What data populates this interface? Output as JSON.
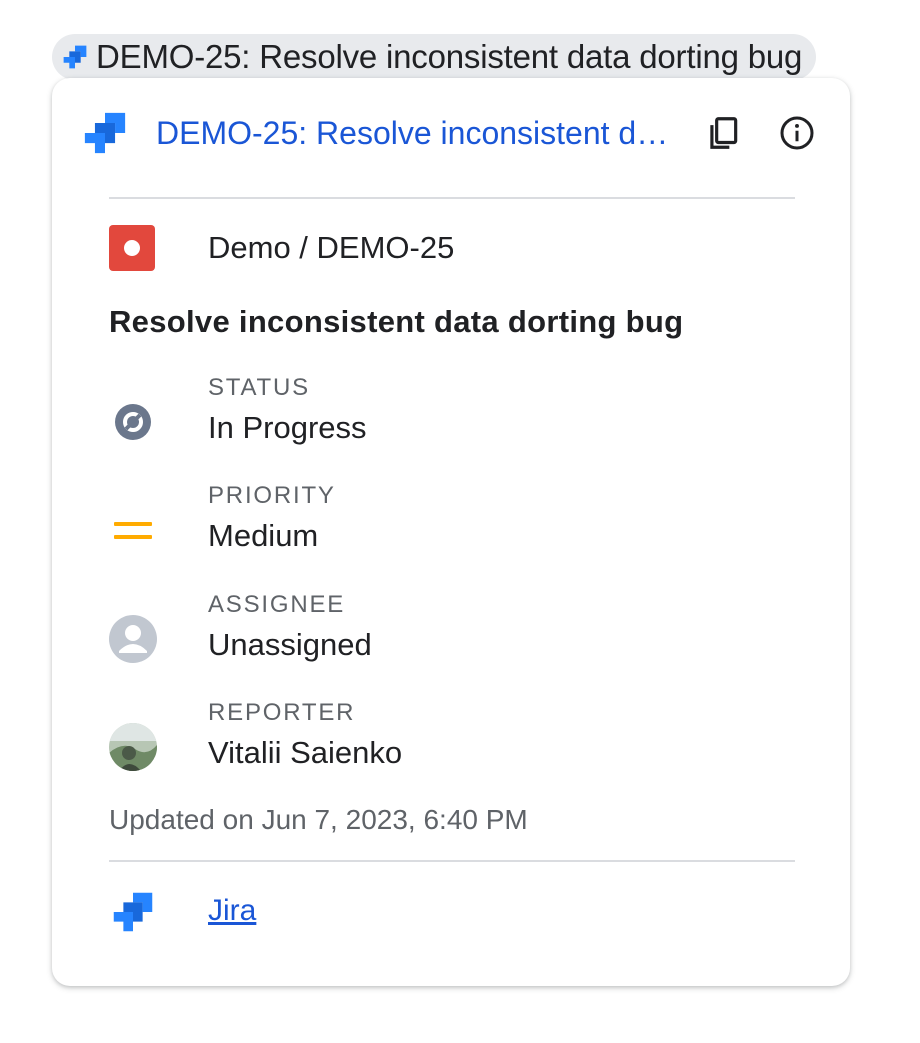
{
  "chip": {
    "text": "DEMO-25: Resolve inconsistent data dorting bug",
    "icon": "jira-icon"
  },
  "card": {
    "title": "DEMO-25: Resolve inconsistent data dorting bug",
    "copy_icon": "copy-icon",
    "info_icon": "info-icon",
    "project": {
      "path": "Demo / DEMO-25",
      "icon": "bug-issue-type-icon",
      "color": "#e2483d"
    },
    "summary": "Resolve inconsistent data dorting bug",
    "fields": [
      {
        "label": "STATUS",
        "value": "In Progress",
        "icon": "status-in-progress-icon"
      },
      {
        "label": "PRIORITY",
        "value": "Medium",
        "icon": "priority-medium-icon"
      },
      {
        "label": "ASSIGNEE",
        "value": "Unassigned",
        "icon": "unassigned-avatar-icon"
      },
      {
        "label": "REPORTER",
        "value": "Vitalii Saienko",
        "icon": "reporter-avatar"
      }
    ],
    "updated": "Updated on Jun 7, 2023, 6:40 PM",
    "footer": {
      "link": "Jira",
      "icon": "jira-icon"
    }
  },
  "colors": {
    "link_blue": "#1a56d6",
    "jira_blue": "#2684ff",
    "priority_orange": "#ffab00",
    "status_gray": "#6b778c"
  }
}
